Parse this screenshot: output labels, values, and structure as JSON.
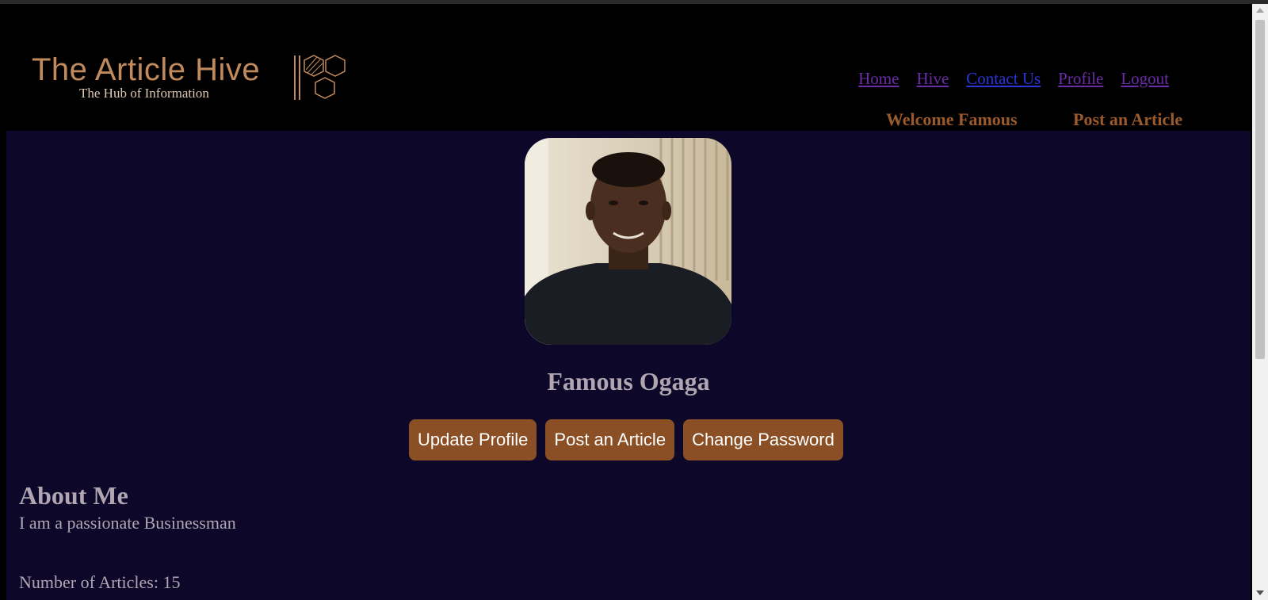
{
  "logo": {
    "title": "The Article Hive",
    "subtitle": "The Hub of Information"
  },
  "nav": {
    "items": [
      {
        "label": "Home"
      },
      {
        "label": "Hive"
      },
      {
        "label": "Contact Us"
      },
      {
        "label": "Profile"
      },
      {
        "label": "Logout"
      }
    ],
    "welcome": "Welcome Famous",
    "post_article": "Post an Article"
  },
  "profile": {
    "name": "Famous Ogaga",
    "buttons": {
      "update": "Update Profile",
      "post": "Post an Article",
      "password": "Change Password"
    },
    "about_heading": "About Me",
    "about_text": "I am a passionate Businessman",
    "articles_count": "Number of Articles: 15"
  },
  "colors": {
    "accent": "#8a4f24",
    "background": "#0d0829",
    "text": "#b0a6b2"
  }
}
